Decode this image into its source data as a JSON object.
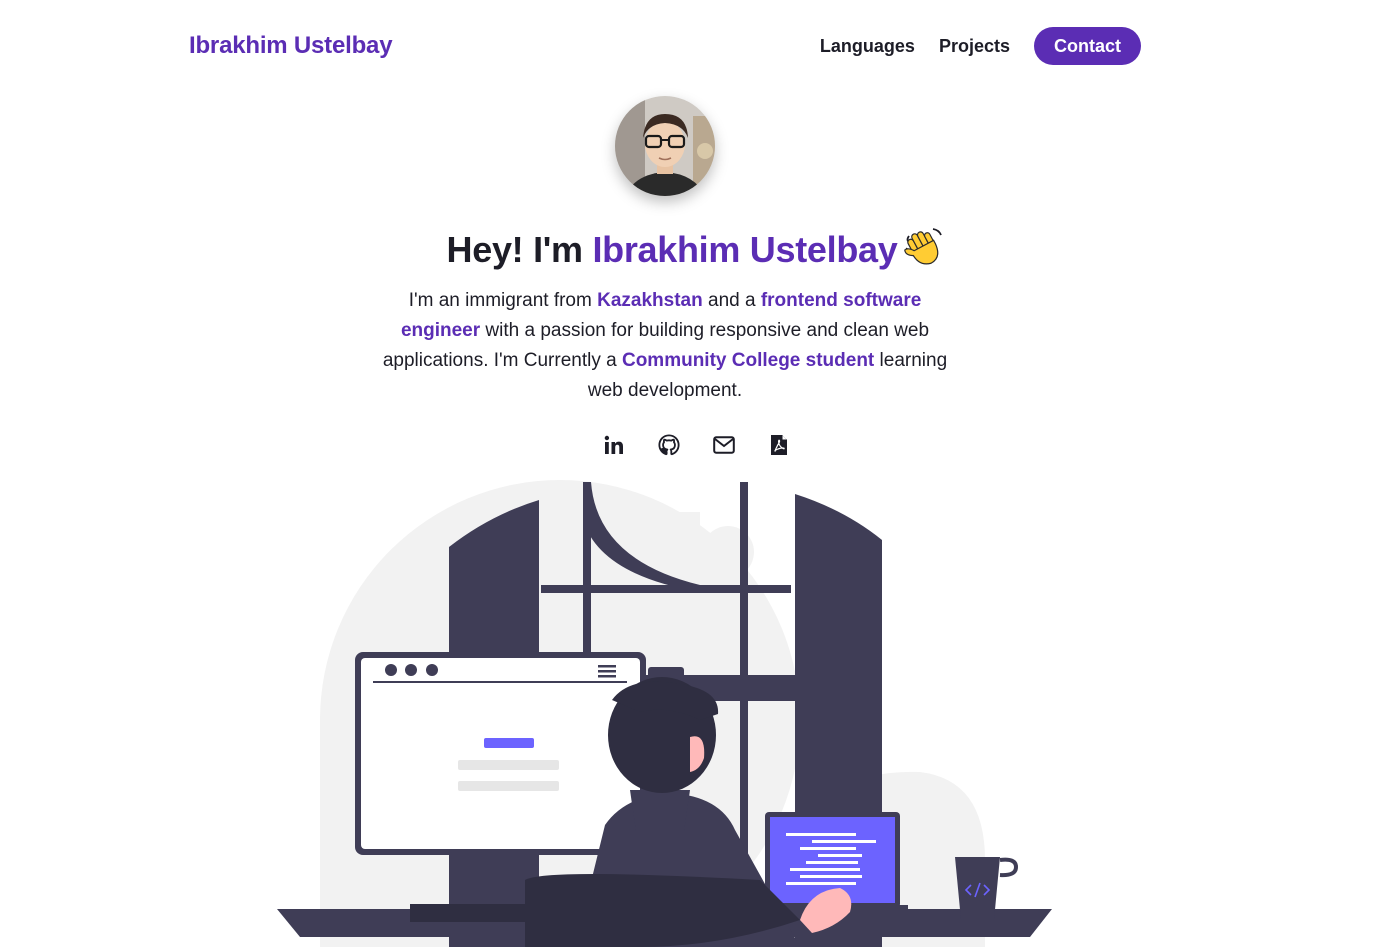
{
  "nav": {
    "brand": "Ibrakhim Ustelbay",
    "links": [
      "Languages",
      "Projects"
    ],
    "contact_label": "Contact"
  },
  "hero": {
    "greeting": "Hey! I'm ",
    "name": "Ibrakhim Ustelbay",
    "wave_icon": "waving-hand-icon",
    "bio": {
      "t1": "I'm an immigrant from ",
      "h1": "Kazakhstan",
      "t2": " and a ",
      "h2": "frontend software engineer",
      "t3": " with a passion for building responsive and clean web applications. I'm Currently a ",
      "h3": "Community College student",
      "t4": " learning web development."
    }
  },
  "socials": [
    "linkedin-icon",
    "github-icon",
    "email-icon",
    "pdf-resume-icon"
  ],
  "colors": {
    "accent": "#5b2db4",
    "text": "#1d1d27",
    "illustration_dark": "#3f3d56",
    "illustration_purple": "#6c63ff",
    "illustration_bg": "#f2f2f2"
  }
}
